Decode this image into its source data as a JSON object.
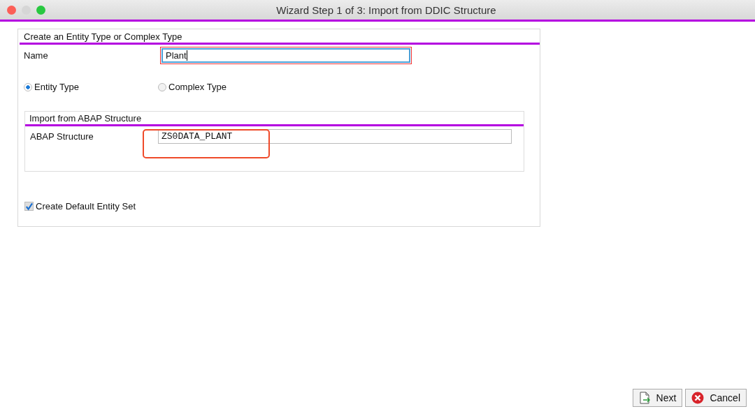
{
  "window": {
    "title": "Wizard Step 1 of 3: Import from DDIC Structure"
  },
  "entity_group": {
    "title": "Create an Entity Type or Complex Type",
    "name_field": {
      "label": "Name",
      "value": "Plant",
      "focused": true
    },
    "type_options": [
      {
        "label": "Entity Type",
        "selected": true
      },
      {
        "label": "Complex Type",
        "selected": false
      }
    ],
    "import_group": {
      "title": "Import from ABAP Structure",
      "structure_field": {
        "label": "ABAP Structure",
        "value": "ZS0DATA_PLANT",
        "highlighted": true
      }
    },
    "default_entity_set": {
      "label": "Create Default Entity Set",
      "checked": true
    }
  },
  "buttons": [
    {
      "kind": "next",
      "label": "Next"
    },
    {
      "kind": "cancel",
      "label": "Cancel"
    }
  ]
}
